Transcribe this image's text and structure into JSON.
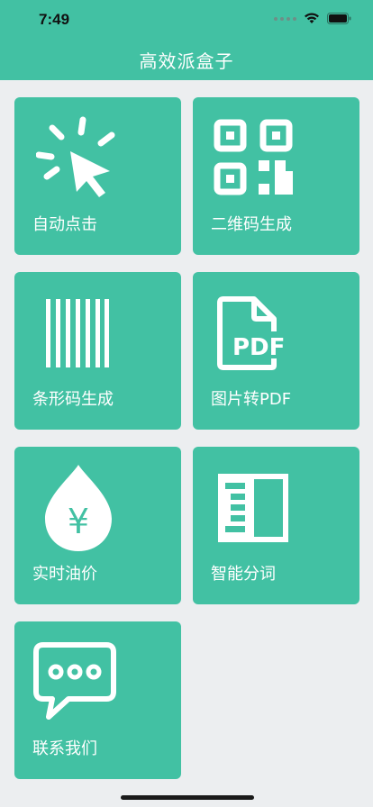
{
  "status": {
    "time": "7:49"
  },
  "nav": {
    "title": "高效派盒子"
  },
  "tiles": [
    {
      "label": "自动点击",
      "icon": "auto-click-icon"
    },
    {
      "label": "二维码生成",
      "icon": "qr-code-icon"
    },
    {
      "label": "条形码生成",
      "icon": "barcode-icon"
    },
    {
      "label": "图片转PDF",
      "icon": "pdf-icon",
      "icon_text": "PDF"
    },
    {
      "label": "实时油价",
      "icon": "oil-drop-icon",
      "icon_text": "¥"
    },
    {
      "label": "智能分词",
      "icon": "book-icon"
    },
    {
      "label": "联系我们",
      "icon": "chat-bubble-icon"
    }
  ],
  "colors": {
    "accent": "#42C1A3",
    "background": "#ECEEF0"
  }
}
